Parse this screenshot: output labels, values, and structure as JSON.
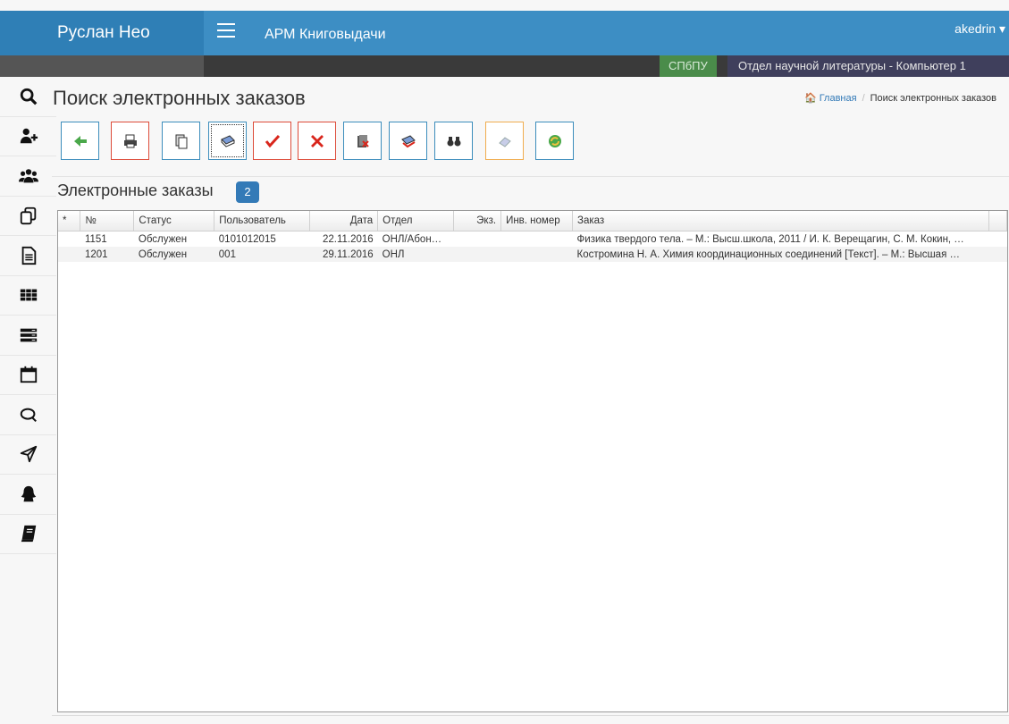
{
  "header": {
    "brand": "Руслан Нео",
    "app_title": "АРМ Книговыдачи",
    "user": "akedrin",
    "org_tag": "СПбПУ",
    "department": "Отдел научной литературы - Компьютер 1"
  },
  "sidebar": {
    "icons": [
      "search-icon",
      "add-user-icon",
      "users-icon",
      "copy-icon",
      "document-icon",
      "grid-icon",
      "server-icon",
      "calendar-icon",
      "comments-icon",
      "send-icon",
      "person-icon",
      "book-icon"
    ]
  },
  "page": {
    "title": "Поиск электронных заказов",
    "breadcrumb": {
      "home": "Главная",
      "current": "Поиск электронных заказов"
    }
  },
  "toolbar": {
    "buttons": [
      "back-icon",
      "print-icon",
      "copy-pages-icon",
      "book-issue-icon",
      "check-icon",
      "delete-icon",
      "book-cancel-icon",
      "book-return-icon",
      "binoculars-icon",
      "eraser-icon",
      "refresh-icon"
    ]
  },
  "orders": {
    "title": "Электронные заказы",
    "count": "2",
    "columns": [
      "*",
      "№",
      "Статус",
      "Пользователь",
      "Дата",
      "Отдел",
      "Экз.",
      "Инв. номер",
      "Заказ"
    ],
    "rows": [
      {
        "star": "",
        "num": "1151",
        "status": "Обслужен",
        "user": "0101012015",
        "date": "22.11.2016",
        "dept": "ОНЛ/Абон…",
        "copies": "",
        "inv": "",
        "order": "Физика твердого тела. – М.: Высш.школа, 2011 / И. К. Верещагин, С. М. Кокин, …"
      },
      {
        "star": "",
        "num": "1201",
        "status": "Обслужен",
        "user": "001",
        "date": "29.11.2016",
        "dept": "ОНЛ",
        "copies": "",
        "inv": "",
        "order": "Костромина Н. А. Химия координационных соединений [Текст]. – М.: Высшая …"
      }
    ]
  },
  "colors": {
    "header": "#3d8ec4",
    "brand": "#2f7fb6",
    "badge": "#337ab7",
    "accent_red": "#dd4b39"
  }
}
